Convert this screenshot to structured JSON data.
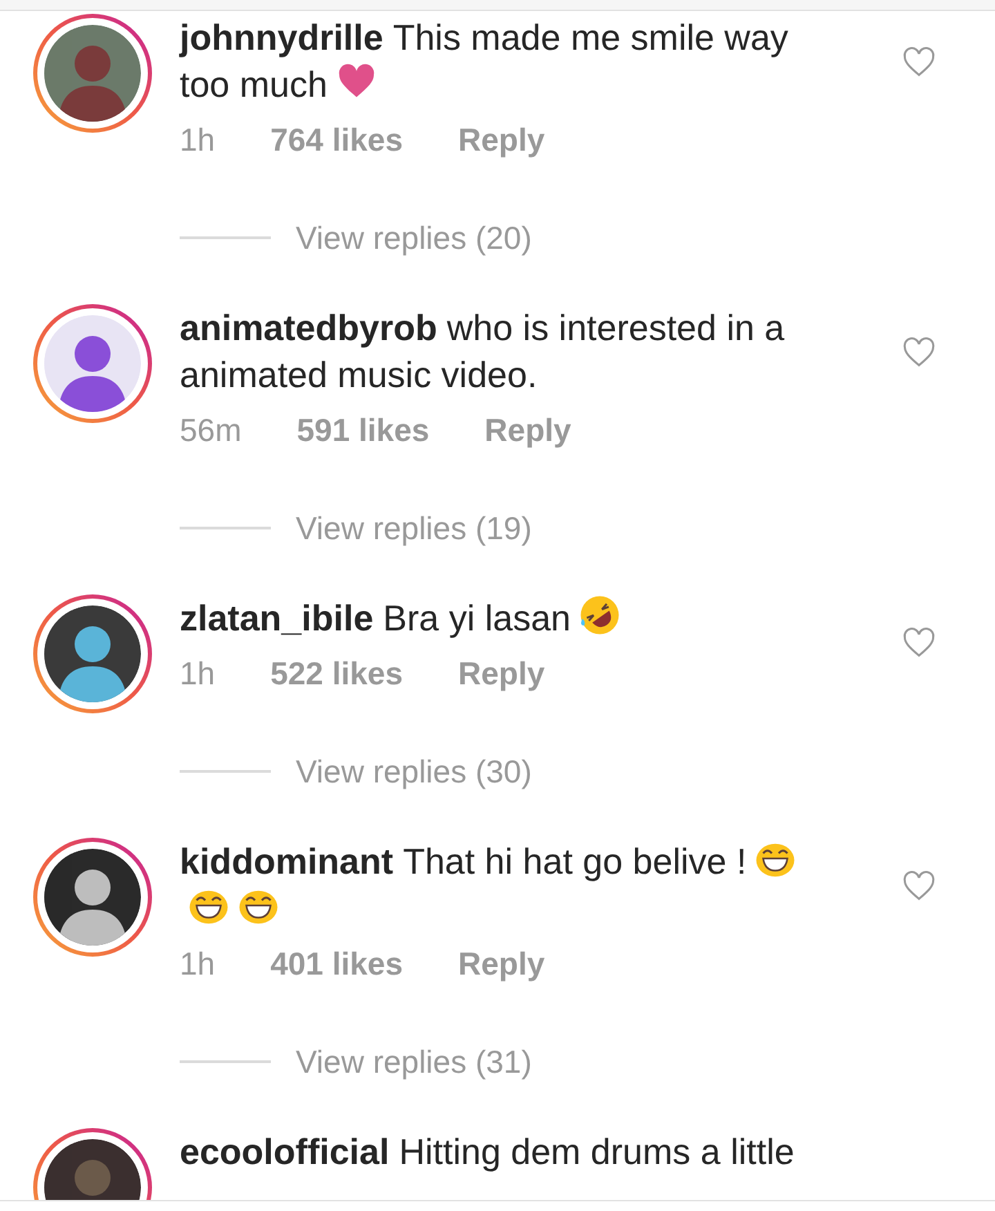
{
  "comments": [
    {
      "username": "johnnydrille",
      "lines": [
        {
          "text": "This made me smile way"
        },
        {
          "text": "too much",
          "emojis": [
            {
              "kind": "heart"
            }
          ]
        }
      ],
      "time": "1h",
      "likes": "764 likes",
      "reply": "Reply",
      "view_replies": "View replies (20)",
      "liked": false
    },
    {
      "username": "animatedbyrob",
      "lines": [
        {
          "text": "who is interested in a"
        },
        {
          "text": "animated music video."
        }
      ],
      "time": "56m",
      "likes": "591 likes",
      "reply": "Reply",
      "view_replies": "View replies (19)",
      "liked": false
    },
    {
      "username": "zlatan_ibile",
      "lines": [
        {
          "text": "Bra yi lasan",
          "emojis": [
            {
              "kind": "rofl"
            }
          ]
        }
      ],
      "time": "1h",
      "likes": "522 likes",
      "reply": "Reply",
      "view_replies": "View replies (30)",
      "liked": false
    },
    {
      "username": "kiddominant",
      "lines": [
        {
          "text": "That hi hat go belive !",
          "emojis": [
            {
              "kind": "laugh"
            }
          ]
        },
        {
          "emojis": [
            {
              "kind": "laugh"
            },
            {
              "kind": "laugh"
            }
          ]
        }
      ],
      "time": "1h",
      "likes": "401 likes",
      "reply": "Reply",
      "view_replies": "View replies (31)",
      "liked": false
    },
    {
      "username": "ecoolofficial",
      "lines": [
        {
          "text": "Hitting dem drums a little"
        }
      ]
    }
  ]
}
